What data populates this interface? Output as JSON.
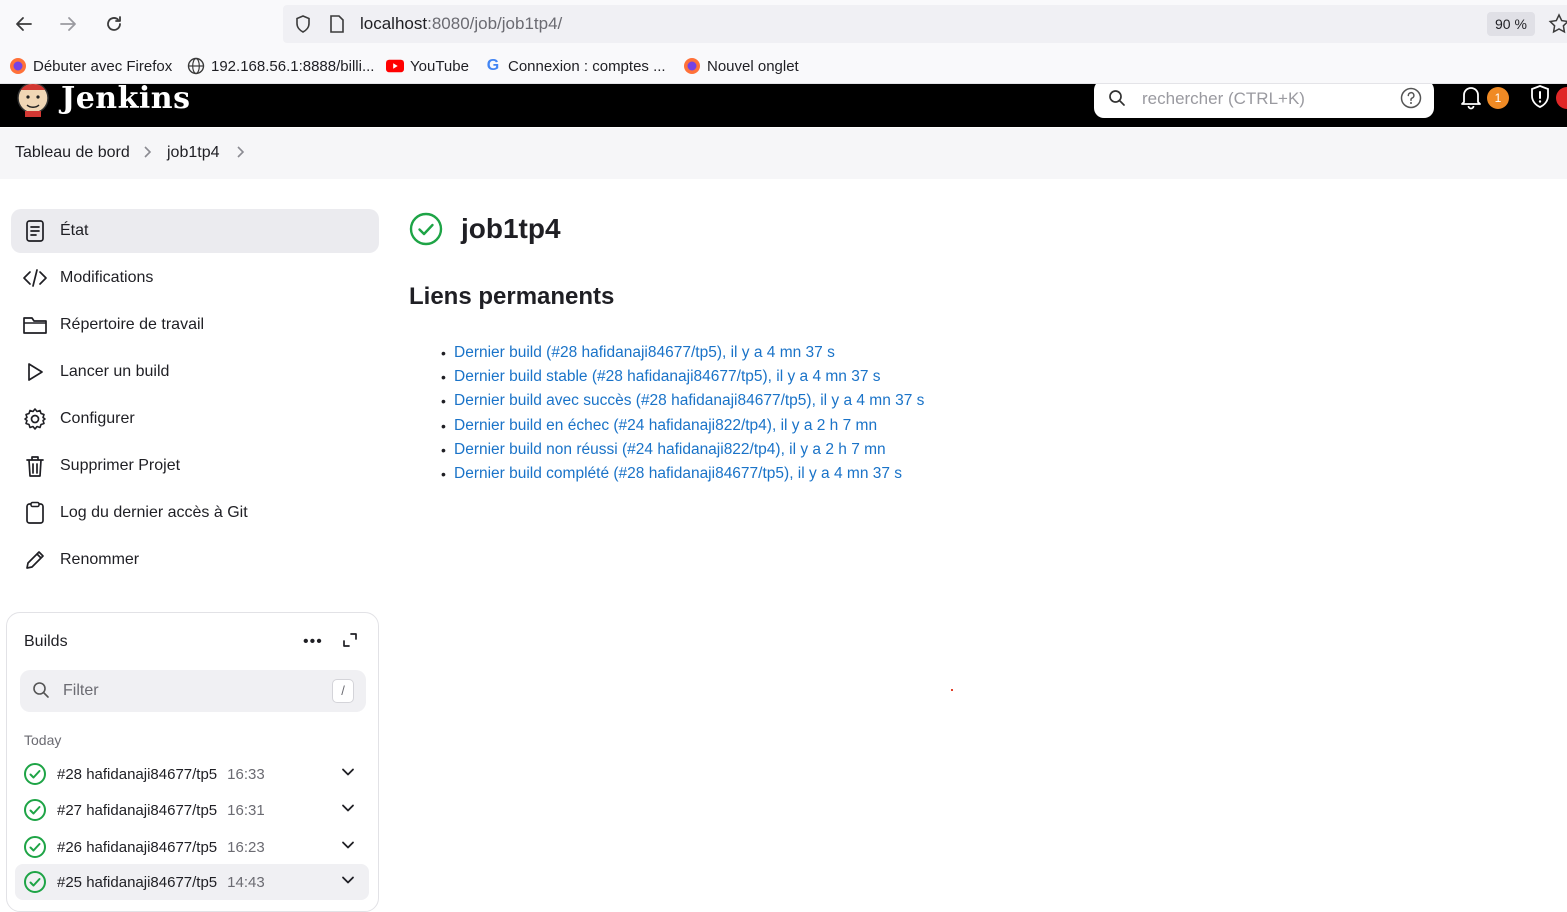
{
  "browser": {
    "url_host": "localhost",
    "url_rest": ":8080/job/job1tp4/",
    "zoom": "90 %",
    "bookmarks": [
      {
        "label": "Débuter avec Firefox",
        "icon": "firefox-icon"
      },
      {
        "label": "192.168.56.1:8888/billi...",
        "icon": "globe-icon"
      },
      {
        "label": "YouTube",
        "icon": "youtube-icon"
      },
      {
        "label": "Connexion : comptes ...",
        "icon": "google-icon"
      },
      {
        "label": "Nouvel onglet",
        "icon": "firefox-icon"
      }
    ]
  },
  "header": {
    "app_name": "Jenkins",
    "search_placeholder": "rechercher (CTRL+K)",
    "notification_count": "1"
  },
  "breadcrumb": {
    "items": [
      "Tableau de bord",
      "job1tp4"
    ]
  },
  "sidebar": {
    "items": [
      {
        "label": "État",
        "icon": "document-icon",
        "active": true
      },
      {
        "label": "Modifications",
        "icon": "code-icon"
      },
      {
        "label": "Répertoire de travail",
        "icon": "folder-icon"
      },
      {
        "label": "Lancer un build",
        "icon": "play-icon"
      },
      {
        "label": "Configurer",
        "icon": "gear-icon"
      },
      {
        "label": "Supprimer Projet",
        "icon": "trash-icon"
      },
      {
        "label": "Log du dernier accès à Git",
        "icon": "clipboard-icon"
      },
      {
        "label": "Renommer",
        "icon": "pencil-icon"
      }
    ]
  },
  "builds": {
    "title": "Builds",
    "more": "•••",
    "filter_placeholder": "Filter",
    "filter_shortcut": "/",
    "group_label": "Today",
    "rows": [
      {
        "name": "#28 hafidanaji84677/tp5",
        "time": "16:33"
      },
      {
        "name": "#27 hafidanaji84677/tp5",
        "time": "16:31"
      },
      {
        "name": "#26 hafidanaji84677/tp5",
        "time": "16:23"
      },
      {
        "name": "#25 hafidanaji84677/tp5",
        "time": "14:43"
      }
    ]
  },
  "main": {
    "job_title": "job1tp4",
    "permalinks_title": "Liens permanents",
    "permalinks": [
      "Dernier build (#28 hafidanaji84677/tp5), il y a 4 mn 37 s",
      "Dernier build stable (#28 hafidanaji84677/tp5), il y a 4 mn 37 s",
      "Dernier build avec succès (#28 hafidanaji84677/tp5), il y a 4 mn 37 s",
      "Dernier build en échec (#24 hafidanaji822/tp4), il y a 2 h 7 mn",
      "Dernier build non réussi (#24 hafidanaji822/tp4), il y a 2 h 7 mn",
      "Dernier build complété (#28 hafidanaji84677/tp5), il y a 4 mn 37 s"
    ]
  },
  "colors": {
    "success": "#1ea446",
    "link": "#1a73c8",
    "notification": "#f08a24",
    "danger": "#e02727"
  }
}
